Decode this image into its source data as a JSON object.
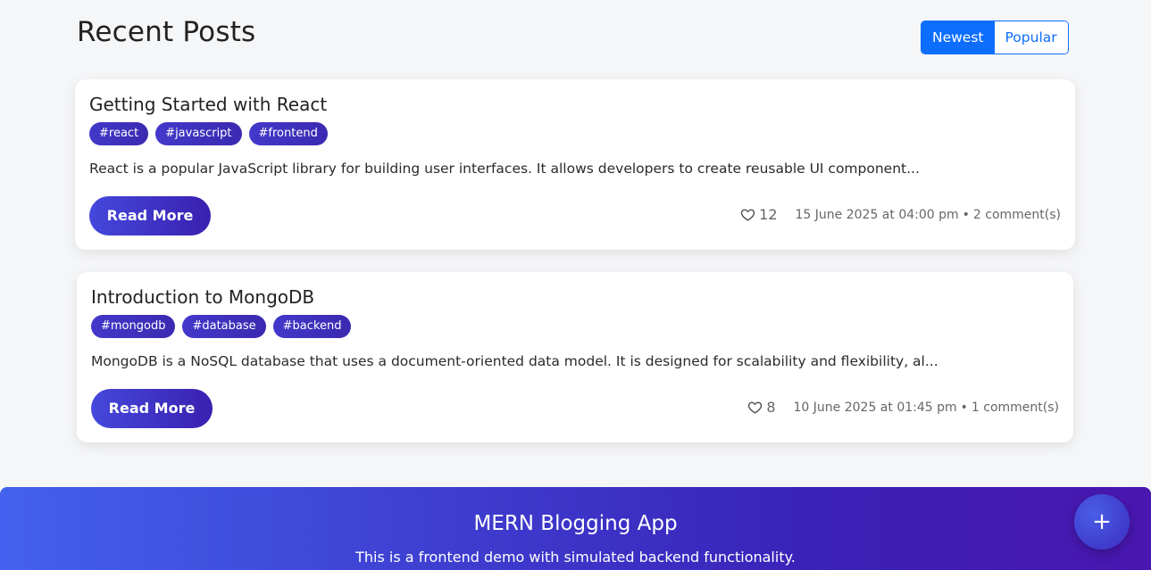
{
  "page": {
    "title": "Recent Posts"
  },
  "sort": {
    "newest_label": "Newest",
    "popular_label": "Popular",
    "active": "Newest"
  },
  "posts": [
    {
      "title": "Getting Started with React",
      "tags": [
        "#react",
        "#javascript",
        "#frontend"
      ],
      "excerpt": "React is a popular JavaScript library for building user interfaces. It allows developers to create reusable UI component...",
      "read_more_label": "Read More",
      "likes": "12",
      "date": "15 June 2025 at 04:00 pm",
      "separator": "•",
      "comments": "2 comment(s)"
    },
    {
      "title": "Introduction to MongoDB",
      "tags": [
        "#mongodb",
        "#database",
        "#backend"
      ],
      "excerpt": "MongoDB is a NoSQL database that uses a document-oriented data model. It is designed for scalability and flexibility, al...",
      "read_more_label": "Read More",
      "likes": "8",
      "date": "10 June 2025 at 01:45 pm",
      "separator": "•",
      "comments": "1 comment(s)"
    }
  ],
  "footer": {
    "title": "MERN Blogging App",
    "subtitle": "This is a frontend demo with simulated backend functionality."
  },
  "fab": {
    "label": "+",
    "icon": "plus-icon"
  },
  "colors": {
    "primary": "#0d6efd",
    "accent": "#4338ca",
    "footer_start": "#4361ee",
    "footer_end": "#4a16b0"
  },
  "icons": {
    "like": "heart-icon"
  }
}
